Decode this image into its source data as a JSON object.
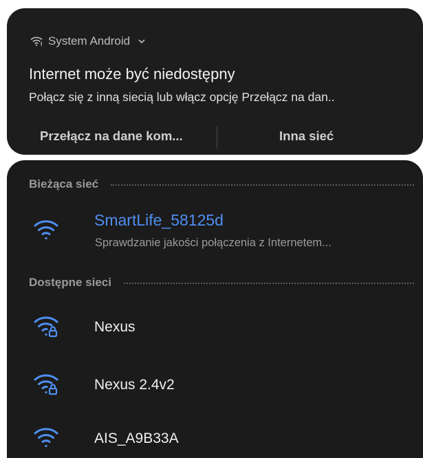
{
  "notification": {
    "app_name": "System Android",
    "title": "Internet może być niedostępny",
    "body": "Połącz się z inną siecią lub włącz opcję Przełącz na dan..",
    "actions": {
      "switch_to_mobile": "Przełącz na dane kom...",
      "other_network": "Inna sieć"
    }
  },
  "wifi": {
    "current_section_label": "Bieżąca sieć",
    "current_network": {
      "name": "SmartLife_58125d",
      "status": "Sprawdzanie jakości połączenia z Internetem...",
      "icon": "wifi-icon"
    },
    "available_section_label": "Dostępne sieci",
    "available_networks": [
      {
        "name": "Nexus",
        "icon": "wifi-lock-icon",
        "secured": true
      },
      {
        "name": "Nexus 2.4v2",
        "icon": "wifi-lock-icon",
        "secured": true
      },
      {
        "name": "AIS_A9B33A",
        "icon": "wifi-icon",
        "secured": false
      }
    ]
  },
  "colors": {
    "accent": "#4f8ff0",
    "panel_background": "#1b1b1b",
    "notification_background": "#1d1d1d"
  }
}
